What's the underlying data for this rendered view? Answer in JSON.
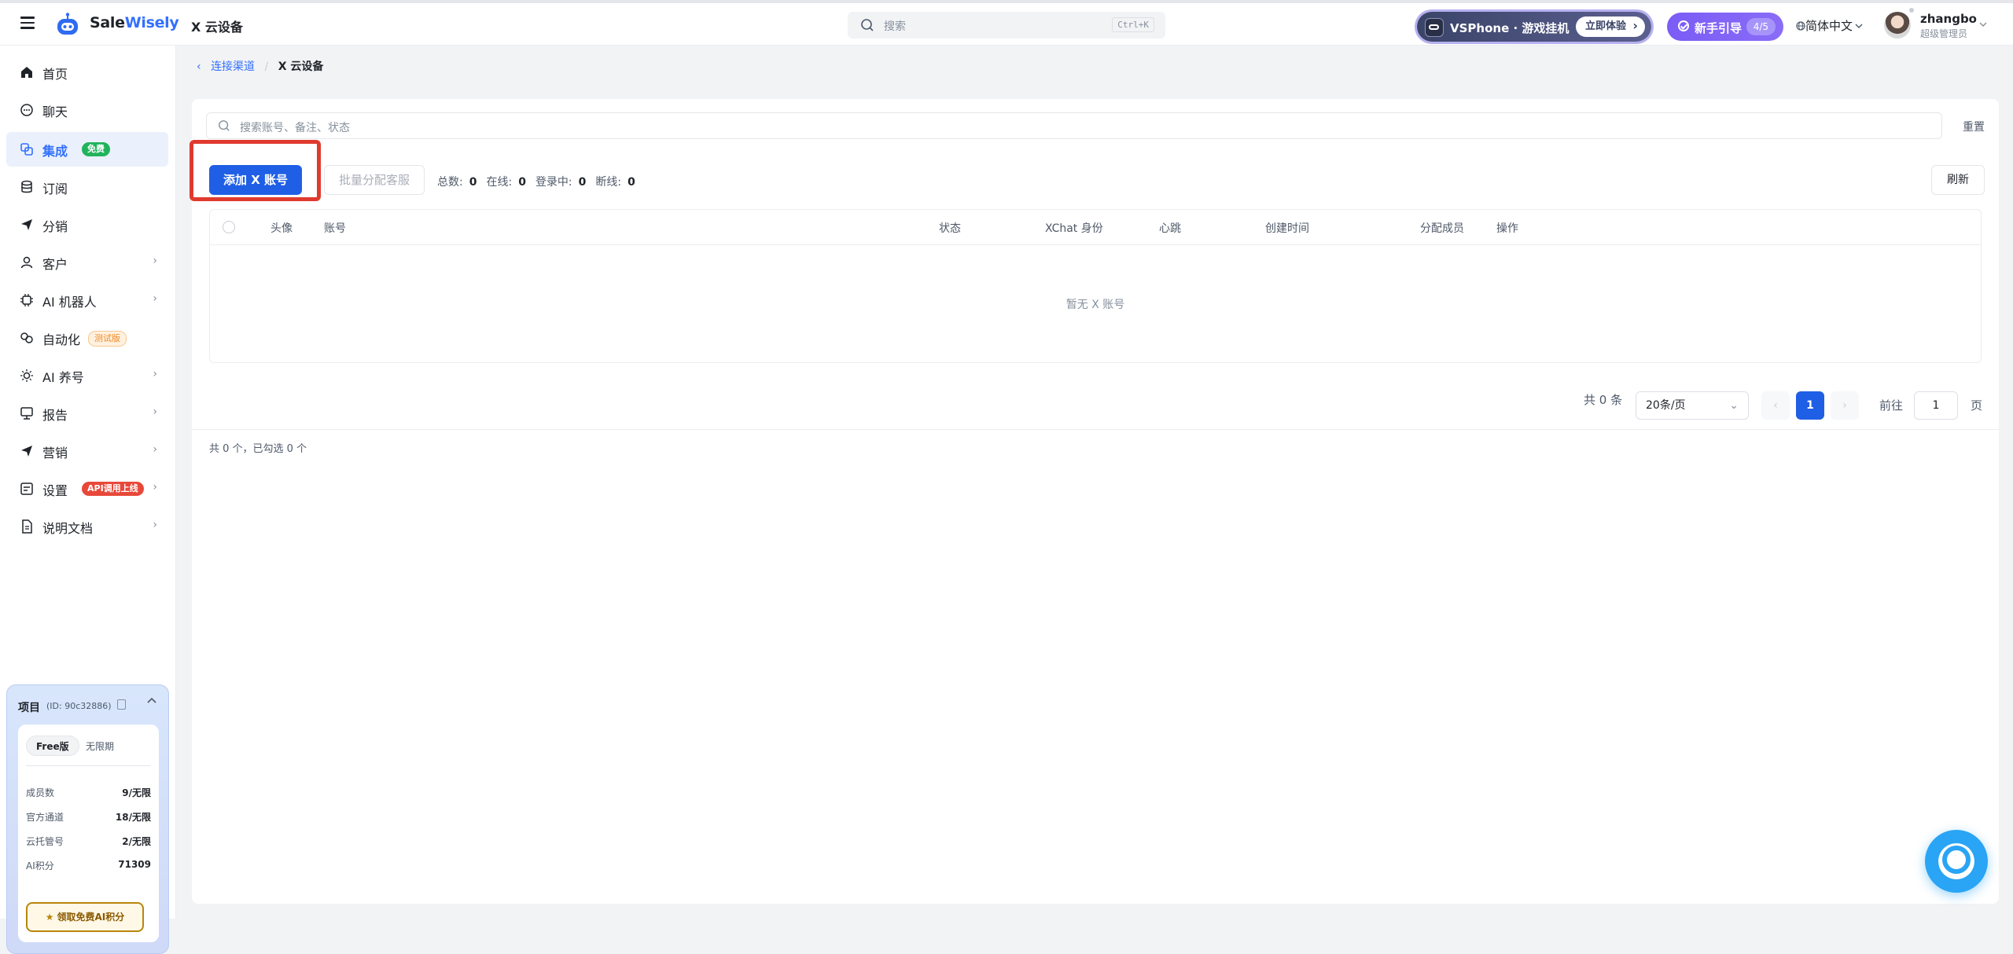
{
  "header": {
    "brand_prefix": "Sale",
    "brand_suffix": "Wisely",
    "page_name": "X 云设备",
    "search_placeholder": "搜索",
    "search_shortcut": "Ctrl+K",
    "promo_text": "VSPhone · 游戏挂机",
    "promo_cta": "立即体验",
    "guide_label": "新手引导",
    "guide_progress": "4/5",
    "language": "简体中文",
    "user_name": "zhangbo",
    "user_role": "超级管理员"
  },
  "sidebar": {
    "items": [
      {
        "label": "首页",
        "icon": "home-icon"
      },
      {
        "label": "聊天",
        "icon": "chat-icon"
      },
      {
        "label": "集成",
        "icon": "integration-icon",
        "badge": "免费"
      },
      {
        "label": "订阅",
        "icon": "database-icon"
      },
      {
        "label": "分销",
        "icon": "send-icon"
      },
      {
        "label": "客户",
        "icon": "user-icon"
      },
      {
        "label": "AI 机器人",
        "icon": "chip-icon"
      },
      {
        "label": "自动化",
        "icon": "automation-icon",
        "badge": "测试版"
      },
      {
        "label": "AI 养号",
        "icon": "sun-icon"
      },
      {
        "label": "报告",
        "icon": "report-icon"
      },
      {
        "label": "营销",
        "icon": "marketing-icon"
      },
      {
        "label": "设置",
        "icon": "settings-icon",
        "badge": "API调用上线"
      },
      {
        "label": "说明文档",
        "icon": "document-icon"
      }
    ],
    "project": {
      "title": "项目",
      "id_text": "(ID: 90c32886)",
      "plan": "Free版",
      "term": "无限期",
      "stats": [
        {
          "label": "成员数",
          "value": "9/无限"
        },
        {
          "label": "官方通道",
          "value": "18/无限"
        },
        {
          "label": "云托管号",
          "value": "2/无限"
        },
        {
          "label": "AI积分",
          "value": "71309"
        }
      ],
      "claim_label": "领取免费AI积分"
    }
  },
  "breadcrumb": {
    "parent": "连接渠道",
    "separator": "/",
    "current": "X 云设备"
  },
  "main": {
    "search_placeholder": "搜索账号、备注、状态",
    "reset_label": "重置",
    "add_button": "添加 X 账号",
    "batch_button": "批量分配客服",
    "stats": {
      "total_label": "总数:",
      "total": "0",
      "online_label": "在线:",
      "online": "0",
      "logging_label": "登录中:",
      "logging": "0",
      "offline_label": "断线:",
      "offline": "0"
    },
    "refresh_label": "刷新",
    "table": {
      "columns": [
        "头像",
        "账号",
        "状态",
        "XChat 身份",
        "心跳",
        "创建时间",
        "分配成员",
        "操作"
      ],
      "rows": [],
      "empty_text": "暂无 X 账号"
    },
    "pagination": {
      "total_text": "共 0 条",
      "page_size": "20条/页",
      "current_page": "1",
      "goto_label": "前往",
      "goto_value": "1",
      "page_suffix": "页"
    },
    "footer_note": "共 0 个，已勾选 0 个"
  },
  "colors": {
    "primary": "#1f5fe5",
    "highlight_box": "#e03a2f",
    "guide_purple": "#7b5cf5"
  }
}
